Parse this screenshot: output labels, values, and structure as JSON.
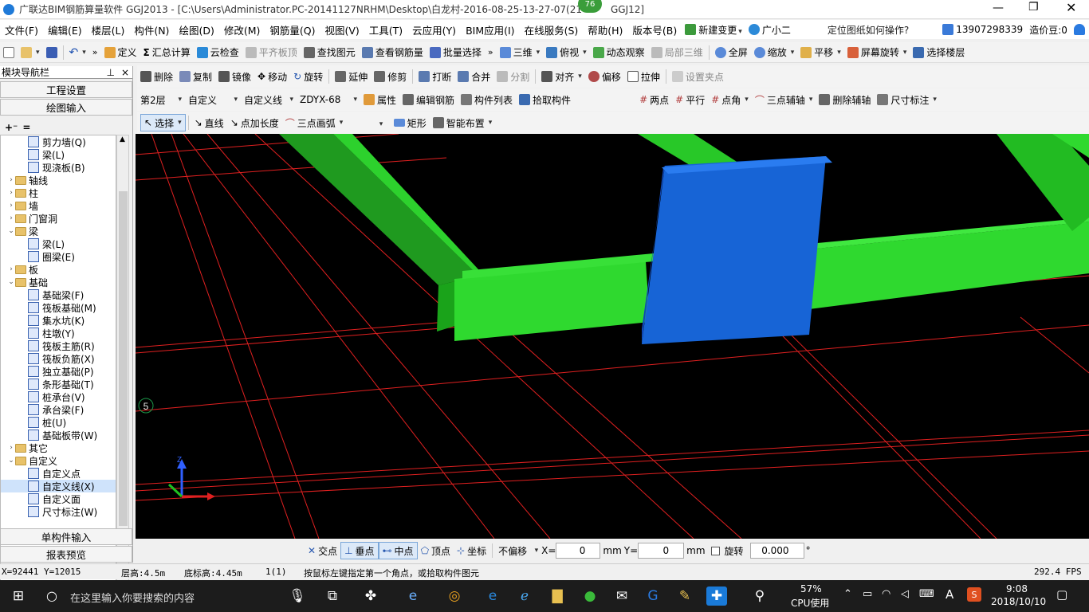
{
  "title": {
    "text": "广联达BIM钢筋算量软件 GGJ2013 - [C:\\Users\\Administrator.PC-20141127NRHM\\Desktop\\白龙村-2016-08-25-13-27-07(21",
    "suffix": "GGJ12]",
    "badge": "76"
  },
  "menu": [
    "文件(F)",
    "编辑(E)",
    "楼层(L)",
    "构件(N)",
    "绘图(D)",
    "修改(M)",
    "钢筋量(Q)",
    "视图(V)",
    "工具(T)",
    "云应用(Y)",
    "BIM应用(I)",
    "在线服务(S)",
    "帮助(H)",
    "版本号(B)",
    "新建变更",
    "广小二"
  ],
  "menu_right": {
    "question": "定位图纸如何操作?",
    "phone": "13907298339",
    "price": "造价豆:0"
  },
  "toolbar1": [
    "定义",
    "汇总计算",
    "云检查",
    "平齐板顶",
    "查找图元",
    "查看钢筋量",
    "批量选择",
    "三维",
    "俯视",
    "动态观察",
    "局部三维",
    "全屏",
    "缩放",
    "平移",
    "屏幕旋转",
    "选择楼层"
  ],
  "toolbar2": [
    "删除",
    "复制",
    "镜像",
    "移动",
    "旋转",
    "延伸",
    "修剪",
    "打断",
    "合并",
    "分割",
    "对齐",
    "偏移",
    "拉伸",
    "设置夹点"
  ],
  "toolbar3": {
    "floor": "第2层",
    "type": "自定义",
    "sub": "自定义线",
    "name": "ZDYX-68",
    "items": [
      "属性",
      "编辑钢筋",
      "构件列表",
      "拾取构件"
    ],
    "right": [
      "两点",
      "平行",
      "点角",
      "三点辅轴",
      "删除辅轴",
      "尺寸标注"
    ]
  },
  "toolbar4": [
    "选择",
    "直线",
    "点加长度",
    "三点画弧",
    "矩形",
    "智能布置"
  ],
  "nav": {
    "header": "模块导航栏",
    "pin": "ꟷ",
    "close": "×",
    "btn1": "工程设置",
    "btn2": "绘图输入",
    "btn3": "单构件输入",
    "btn4": "报表预览"
  },
  "tree": [
    {
      "t": "剪力墙(Q)",
      "lv": 2,
      "k": "leaf"
    },
    {
      "t": "梁(L)",
      "lv": 2,
      "k": "leaf"
    },
    {
      "t": "现浇板(B)",
      "lv": 2,
      "k": "leaf"
    },
    {
      "t": "轴线",
      "lv": 1,
      "k": "fold",
      "e": "›"
    },
    {
      "t": "柱",
      "lv": 1,
      "k": "fold",
      "e": "›"
    },
    {
      "t": "墙",
      "lv": 1,
      "k": "fold",
      "e": "›"
    },
    {
      "t": "门窗洞",
      "lv": 1,
      "k": "fold",
      "e": "›"
    },
    {
      "t": "梁",
      "lv": 1,
      "k": "fold",
      "e": "⌄"
    },
    {
      "t": "梁(L)",
      "lv": 2,
      "k": "leaf"
    },
    {
      "t": "圈梁(E)",
      "lv": 2,
      "k": "leaf"
    },
    {
      "t": "板",
      "lv": 1,
      "k": "fold",
      "e": "›"
    },
    {
      "t": "基础",
      "lv": 1,
      "k": "fold",
      "e": "⌄"
    },
    {
      "t": "基础梁(F)",
      "lv": 2,
      "k": "leaf"
    },
    {
      "t": "筏板基础(M)",
      "lv": 2,
      "k": "leaf"
    },
    {
      "t": "集水坑(K)",
      "lv": 2,
      "k": "leaf"
    },
    {
      "t": "柱墩(Y)",
      "lv": 2,
      "k": "leaf"
    },
    {
      "t": "筏板主筋(R)",
      "lv": 2,
      "k": "leaf"
    },
    {
      "t": "筏板负筋(X)",
      "lv": 2,
      "k": "leaf"
    },
    {
      "t": "独立基础(P)",
      "lv": 2,
      "k": "leaf"
    },
    {
      "t": "条形基础(T)",
      "lv": 2,
      "k": "leaf"
    },
    {
      "t": "桩承台(V)",
      "lv": 2,
      "k": "leaf"
    },
    {
      "t": "承台梁(F)",
      "lv": 2,
      "k": "leaf"
    },
    {
      "t": "桩(U)",
      "lv": 2,
      "k": "leaf"
    },
    {
      "t": "基础板带(W)",
      "lv": 2,
      "k": "leaf"
    },
    {
      "t": "其它",
      "lv": 1,
      "k": "fold",
      "e": "›"
    },
    {
      "t": "自定义",
      "lv": 1,
      "k": "fold",
      "e": "⌄"
    },
    {
      "t": "自定义点",
      "lv": 2,
      "k": "leaf"
    },
    {
      "t": "自定义线(X)",
      "lv": 2,
      "k": "leaf",
      "sel": true
    },
    {
      "t": "自定义面",
      "lv": 2,
      "k": "leaf"
    },
    {
      "t": "尺寸标注(W)",
      "lv": 2,
      "k": "leaf"
    }
  ],
  "canvas": {
    "axis_label": "5"
  },
  "snap": {
    "items": [
      "交点",
      "垂点",
      "中点",
      "顶点",
      "坐标"
    ],
    "offset": "不偏移",
    "x_label": "X=",
    "x": "0",
    "y_label": "Y=",
    "y": "0",
    "unit": "mm",
    "rotate": "旋转",
    "angle": "0.000",
    "deg": "°"
  },
  "status": {
    "coords": "X=92441 Y=12015",
    "floor_h": "层高:4.5m",
    "base_h": "底标高:4.45m",
    "count": "1(1)",
    "hint": "按鼠标左键指定第一个角点，或拾取构件图元",
    "fps": "292.4 FPS"
  },
  "taskbar": {
    "search": "在这里输入你要搜索的内容",
    "cpu_pct": "57%",
    "cpu_label": "CPU使用",
    "time": "9:08",
    "date": "2018/10/10",
    "ime": "A"
  }
}
